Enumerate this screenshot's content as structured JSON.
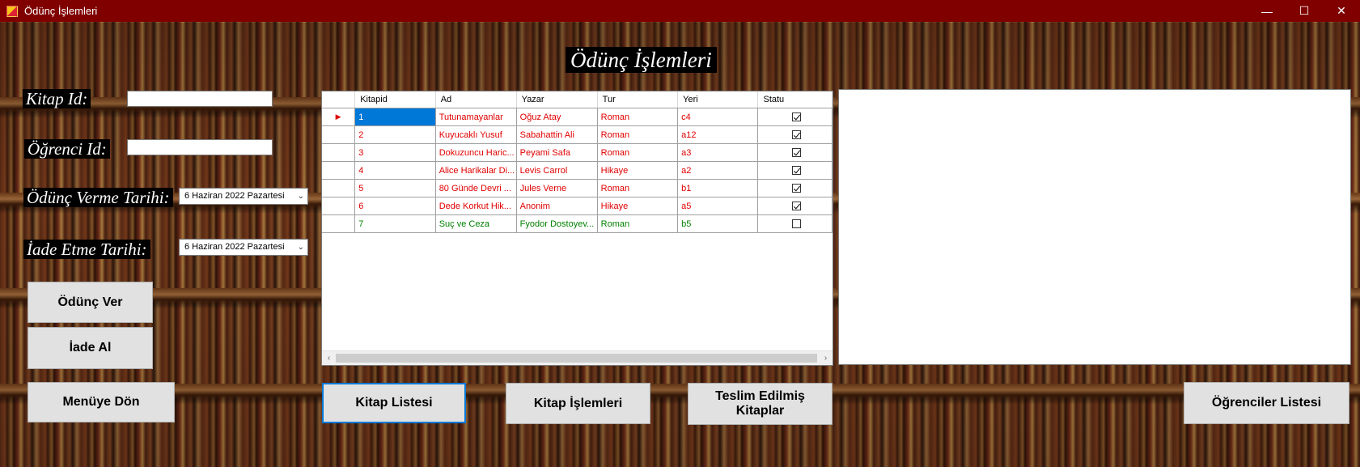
{
  "window": {
    "title": "Ödünç İşlemleri",
    "controls": {
      "minimize": "—",
      "maximize": "☐",
      "close": "✕"
    }
  },
  "heading": "Ödünç İşlemleri",
  "form": {
    "kitap_id_label": "Kitap Id:",
    "kitap_id_value": "",
    "ogrenci_id_label": "Öğrenci Id:",
    "ogrenci_id_value": "",
    "odunc_tarihi_label": "Ödünç Verme Tarihi:",
    "odunc_tarihi_value": "6  Haziran  2022  Pazartesi",
    "iade_tarihi_label": "İade Etme Tarihi:",
    "iade_tarihi_value": "6  Haziran  2022  Pazartesi"
  },
  "buttons": {
    "odunc_ver": "Ödünç Ver",
    "iade_al": "İade Al",
    "menuye_don": "Menüye Dön",
    "kitap_listesi": "Kitap Listesi",
    "kitap_islemleri": "Kitap İşlemleri",
    "teslim_edilmis_line1": "Teslim Edilmiş",
    "teslim_edilmis_line2": "Kitaplar",
    "ogrenciler_listesi": "Öğrenciler Listesi"
  },
  "grid": {
    "columns": [
      "Kitapid",
      "Ad",
      "Yazar",
      "Tur",
      "Yeri",
      "Statu"
    ],
    "rows": [
      {
        "kitapid": "1",
        "ad": "Tutunamayanlar",
        "yazar": "Oğuz Atay",
        "tur": "Roman",
        "yeri": "c4",
        "statu": true
      },
      {
        "kitapid": "2",
        "ad": "Kuyucaklı Yusuf",
        "yazar": "Sabahattin Ali",
        "tur": "Roman",
        "yeri": "a12",
        "statu": true
      },
      {
        "kitapid": "3",
        "ad": "Dokuzuncu Haric...",
        "yazar": "Peyami Safa",
        "tur": "Roman",
        "yeri": "a3",
        "statu": true
      },
      {
        "kitapid": "4",
        "ad": "Alice Harikalar Di...",
        "yazar": "Levis Carrol",
        "tur": "Hikaye",
        "yeri": "a2",
        "statu": true
      },
      {
        "kitapid": "5",
        "ad": "80 Günde Devri ...",
        "yazar": "Jules Verne",
        "tur": "Roman",
        "yeri": "b1",
        "statu": true
      },
      {
        "kitapid": "6",
        "ad": "Dede Korkut Hik...",
        "yazar": "Anonim",
        "tur": "Hikaye",
        "yeri": "a5",
        "statu": true
      },
      {
        "kitapid": "7",
        "ad": "Suç ve Ceza",
        "yazar": "Fyodor Dostoyev...",
        "tur": "Roman",
        "yeri": "b5",
        "statu": false
      }
    ],
    "current_row_marker": "▶",
    "scroll_left": "‹",
    "scroll_right": "›"
  },
  "colors": {
    "titlebar": "#800000",
    "row_active": "#e00000",
    "row_available": "#008000",
    "selection": "#0078d7"
  }
}
